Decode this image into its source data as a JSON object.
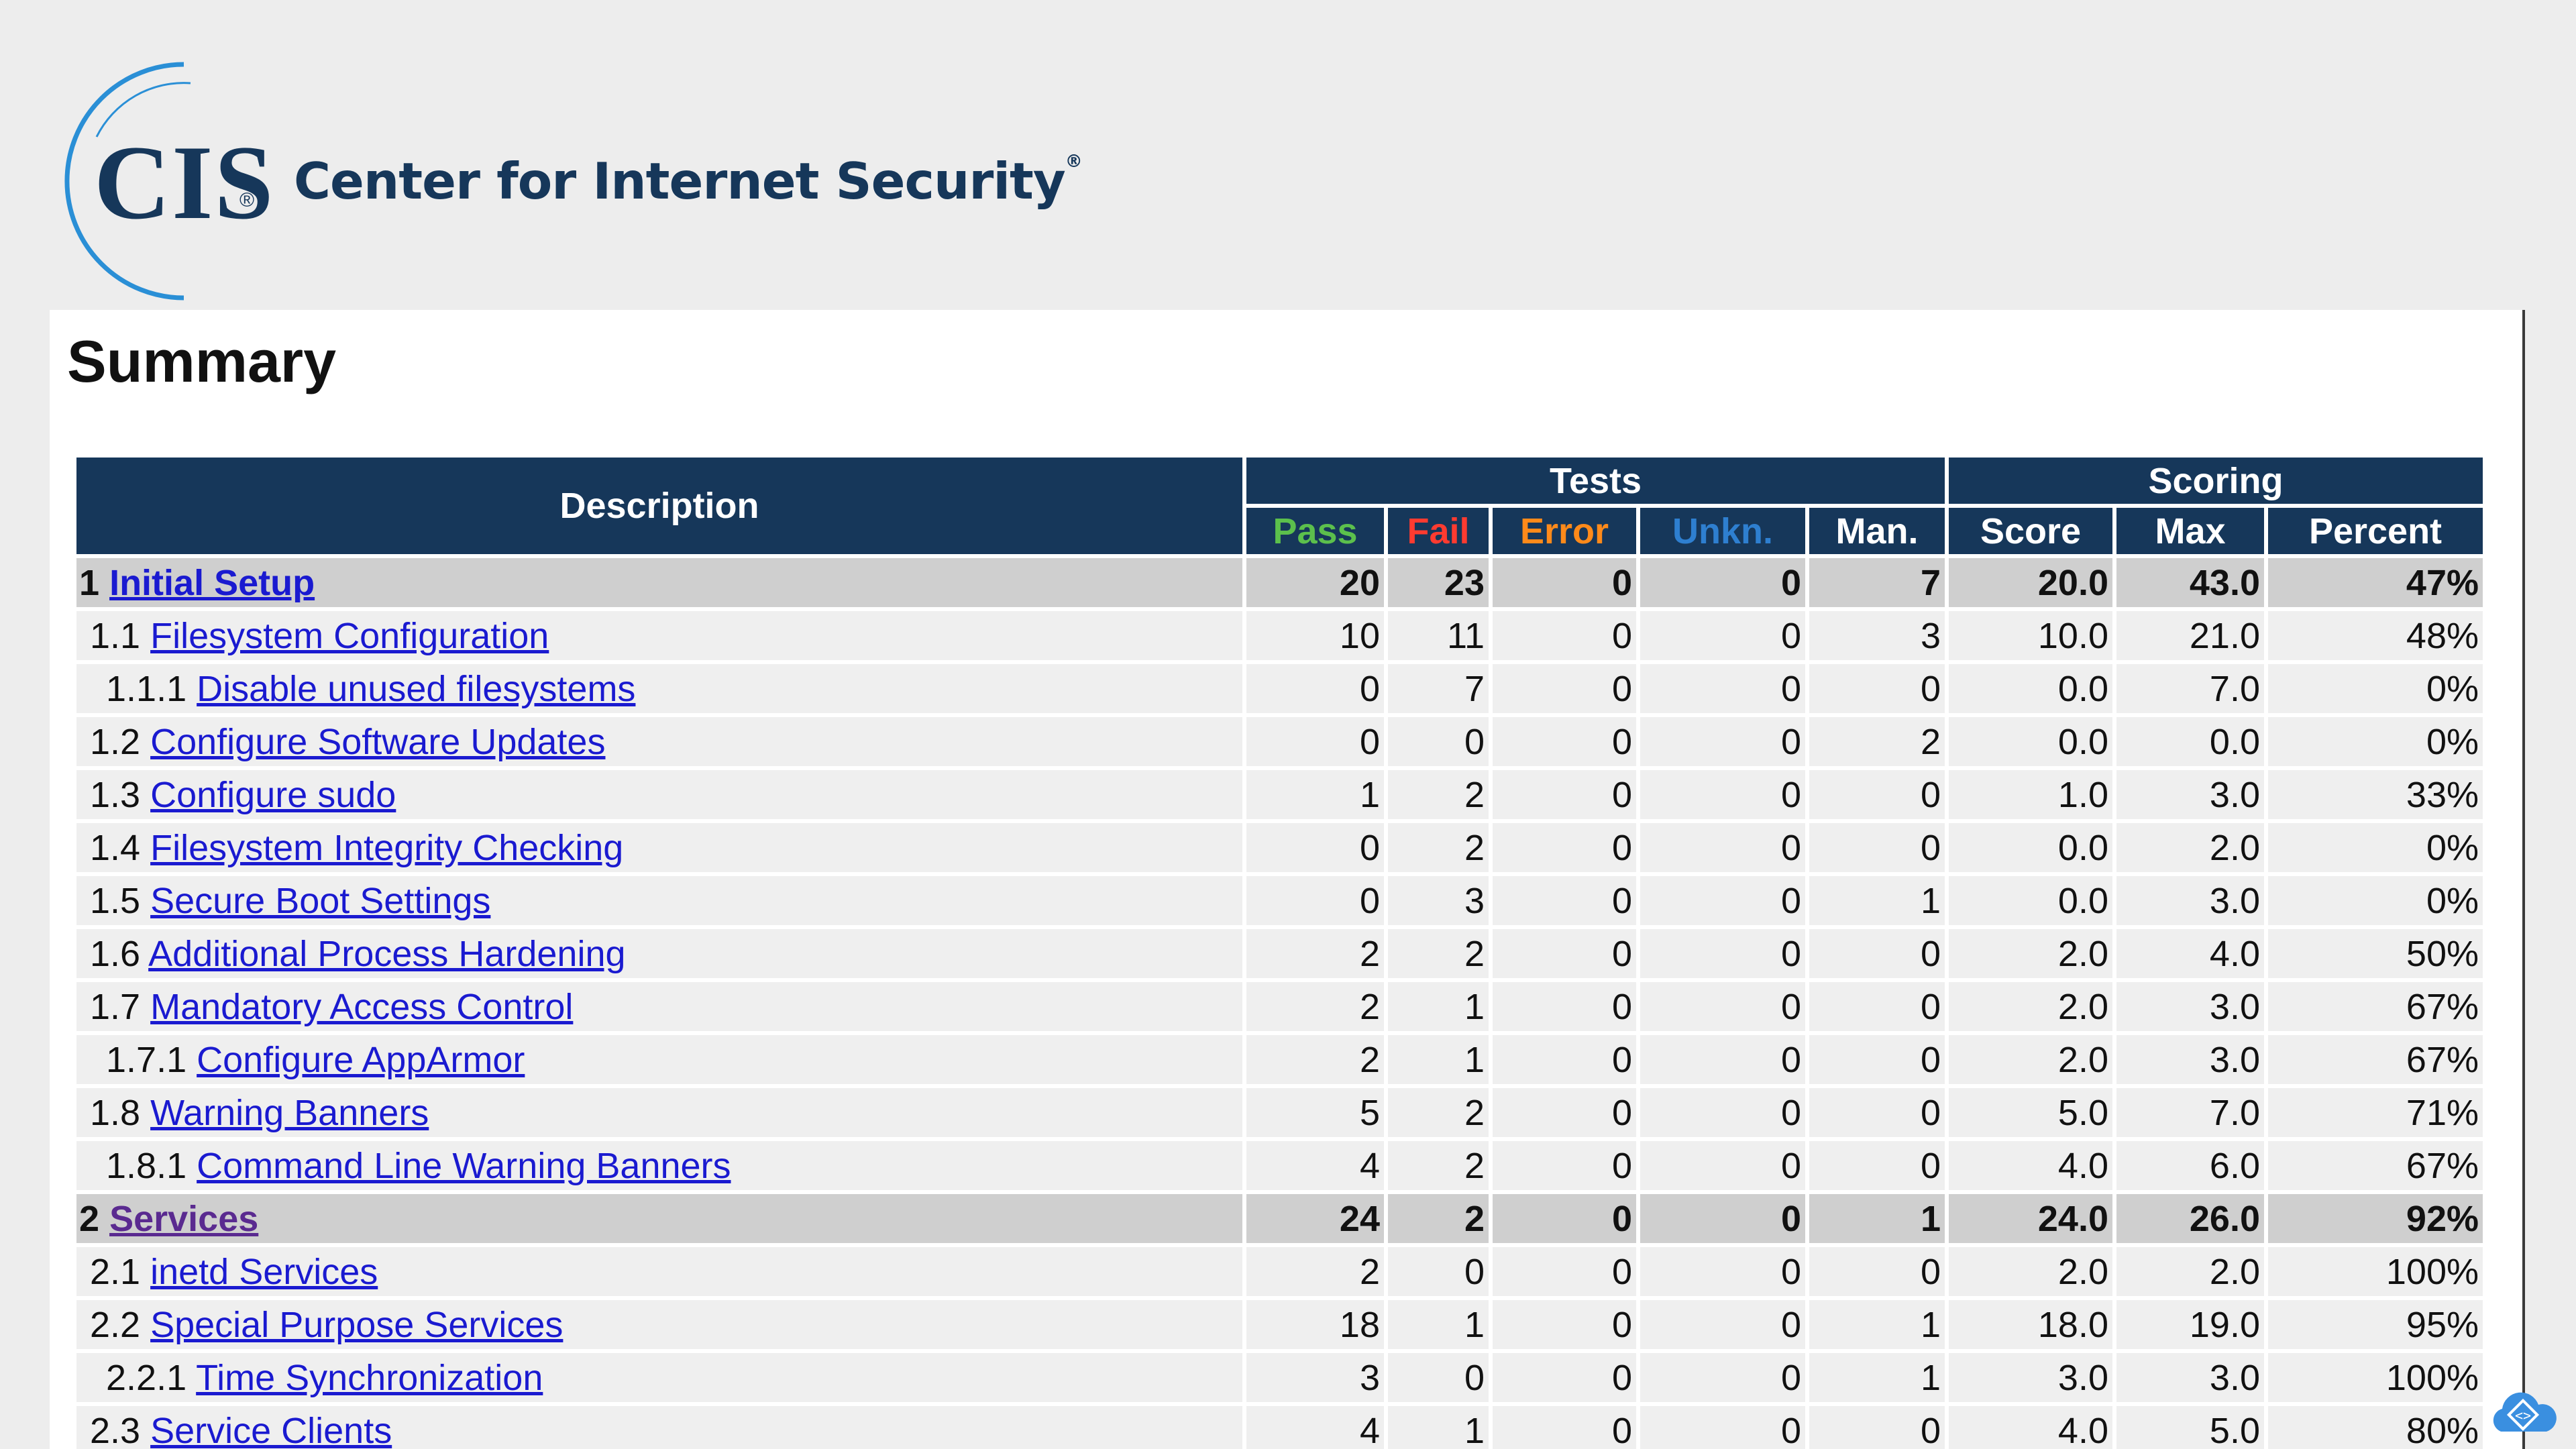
{
  "header": {
    "logo_text": "CIS",
    "logo_reg": "®",
    "org_name": "Center for Internet Security",
    "org_reg": "®"
  },
  "summary": {
    "title": "Summary",
    "columns": {
      "description": "Description",
      "tests_group": "Tests",
      "scoring_group": "Scoring",
      "pass": "Pass",
      "fail": "Fail",
      "error": "Error",
      "unknown": "Unkn.",
      "manual": "Man.",
      "score": "Score",
      "max": "Max",
      "percent": "Percent"
    },
    "colors": {
      "header_bg": "#16375a",
      "pass": "#5cc04c",
      "fail": "#ff3b30",
      "error": "#ff8a1a",
      "unknown": "#2e7fd0",
      "category_row": "#cfcfcf",
      "row": "#efefef",
      "link": "#1a1ad0"
    },
    "rows": [
      {
        "num": "1",
        "label": "Initial Setup",
        "pass": "20",
        "fail": "23",
        "error": "0",
        "unkn": "0",
        "man": "7",
        "score": "20.0",
        "max": "43.0",
        "pct": "47%"
      },
      {
        "num": "1.1",
        "label": "Filesystem Configuration",
        "pass": "10",
        "fail": "11",
        "error": "0",
        "unkn": "0",
        "man": "3",
        "score": "10.0",
        "max": "21.0",
        "pct": "48%"
      },
      {
        "num": "1.1.1",
        "label": "Disable unused filesystems",
        "pass": "0",
        "fail": "7",
        "error": "0",
        "unkn": "0",
        "man": "0",
        "score": "0.0",
        "max": "7.0",
        "pct": "0%"
      },
      {
        "num": "1.2",
        "label": "Configure Software Updates",
        "pass": "0",
        "fail": "0",
        "error": "0",
        "unkn": "0",
        "man": "2",
        "score": "0.0",
        "max": "0.0",
        "pct": "0%"
      },
      {
        "num": "1.3",
        "label": "Configure sudo",
        "pass": "1",
        "fail": "2",
        "error": "0",
        "unkn": "0",
        "man": "0",
        "score": "1.0",
        "max": "3.0",
        "pct": "33%"
      },
      {
        "num": "1.4",
        "label": "Filesystem Integrity Checking",
        "pass": "0",
        "fail": "2",
        "error": "0",
        "unkn": "0",
        "man": "0",
        "score": "0.0",
        "max": "2.0",
        "pct": "0%"
      },
      {
        "num": "1.5",
        "label": "Secure Boot Settings",
        "pass": "0",
        "fail": "3",
        "error": "0",
        "unkn": "0",
        "man": "1",
        "score": "0.0",
        "max": "3.0",
        "pct": "0%"
      },
      {
        "num": "1.6",
        "label": "Additional Process Hardening",
        "pass": "2",
        "fail": "2",
        "error": "0",
        "unkn": "0",
        "man": "0",
        "score": "2.0",
        "max": "4.0",
        "pct": "50%"
      },
      {
        "num": "1.7",
        "label": "Mandatory Access Control",
        "pass": "2",
        "fail": "1",
        "error": "0",
        "unkn": "0",
        "man": "0",
        "score": "2.0",
        "max": "3.0",
        "pct": "67%"
      },
      {
        "num": "1.7.1",
        "label": "Configure AppArmor",
        "pass": "2",
        "fail": "1",
        "error": "0",
        "unkn": "0",
        "man": "0",
        "score": "2.0",
        "max": "3.0",
        "pct": "67%"
      },
      {
        "num": "1.8",
        "label": "Warning Banners",
        "pass": "5",
        "fail": "2",
        "error": "0",
        "unkn": "0",
        "man": "0",
        "score": "5.0",
        "max": "7.0",
        "pct": "71%"
      },
      {
        "num": "1.8.1",
        "label": "Command Line Warning Banners",
        "pass": "4",
        "fail": "2",
        "error": "0",
        "unkn": "0",
        "man": "0",
        "score": "4.0",
        "max": "6.0",
        "pct": "67%"
      },
      {
        "num": "2",
        "label": "Services",
        "pass": "24",
        "fail": "2",
        "error": "0",
        "unkn": "0",
        "man": "1",
        "score": "24.0",
        "max": "26.0",
        "pct": "92%"
      },
      {
        "num": "2.1",
        "label": "inetd Services",
        "pass": "2",
        "fail": "0",
        "error": "0",
        "unkn": "0",
        "man": "0",
        "score": "2.0",
        "max": "2.0",
        "pct": "100%"
      },
      {
        "num": "2.2",
        "label": "Special Purpose Services",
        "pass": "18",
        "fail": "1",
        "error": "0",
        "unkn": "0",
        "man": "1",
        "score": "18.0",
        "max": "19.0",
        "pct": "95%"
      },
      {
        "num": "2.2.1",
        "label": "Time Synchronization",
        "pass": "3",
        "fail": "0",
        "error": "0",
        "unkn": "0",
        "man": "1",
        "score": "3.0",
        "max": "3.0",
        "pct": "100%"
      },
      {
        "num": "2.3",
        "label": "Service Clients",
        "pass": "4",
        "fail": "1",
        "error": "0",
        "unkn": "0",
        "man": "0",
        "score": "4.0",
        "max": "5.0",
        "pct": "80%"
      }
    ]
  },
  "icons": {
    "corner": "cloud-code-icon"
  }
}
